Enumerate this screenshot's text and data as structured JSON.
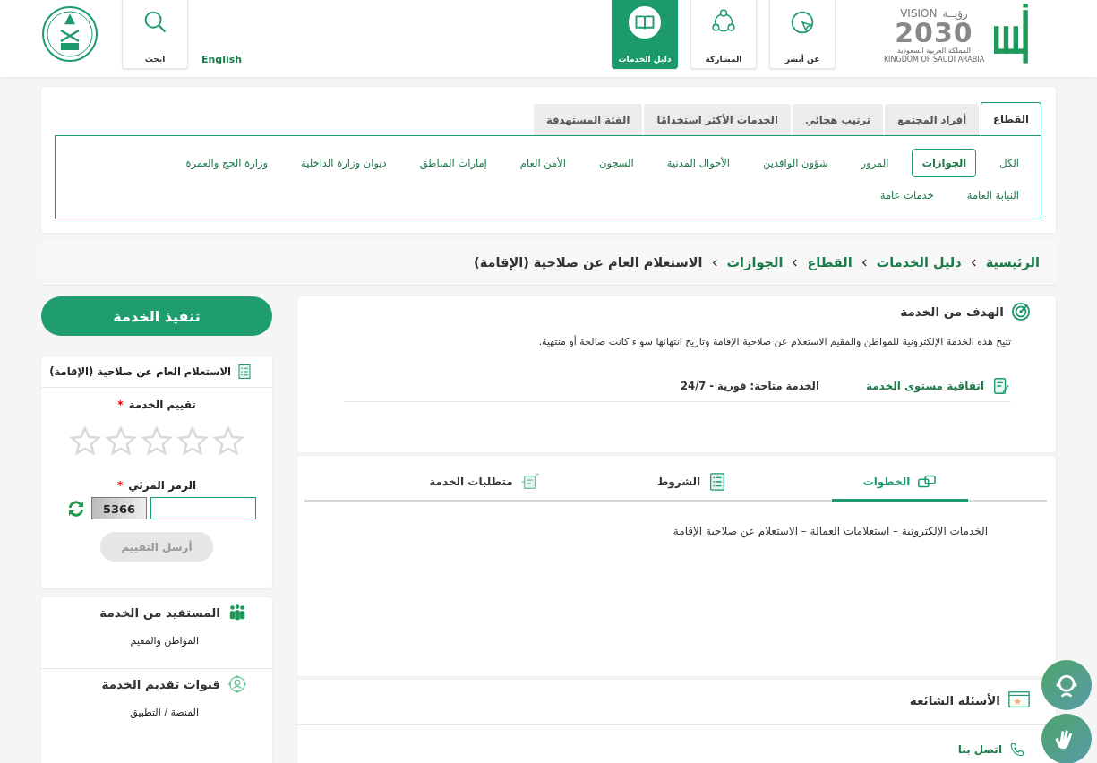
{
  "header": {
    "vision": {
      "word": "VISION",
      "arabic_word": "رؤيــة",
      "year": "2030",
      "country_ar": "المملكة العربية السعودية",
      "country_en": "KINGDOM OF SAUDI ARABIA"
    },
    "nav": [
      {
        "label": "عن أبشر",
        "kind": "about",
        "selected": false
      },
      {
        "label": "المشاركة",
        "kind": "share",
        "selected": false
      },
      {
        "label": "دليل الخدمات",
        "kind": "guide",
        "selected": true
      }
    ],
    "language": "English",
    "search": "ابحث"
  },
  "category_tabs": [
    {
      "label": "القطاع",
      "selected": true
    },
    {
      "label": "أفراد المجتمع",
      "selected": false
    },
    {
      "label": "ترتيب هجائي",
      "selected": false
    },
    {
      "label": "الخدمات الأكثر استخدامًا",
      "selected": false
    },
    {
      "label": "الفئة المستهدفة",
      "selected": false
    }
  ],
  "sectors": [
    {
      "label": "الكل",
      "selected": false
    },
    {
      "label": "الجوازات",
      "selected": true
    },
    {
      "label": "المرور",
      "selected": false
    },
    {
      "label": "شؤون الوافدين",
      "selected": false
    },
    {
      "label": "الأحوال المدنية",
      "selected": false
    },
    {
      "label": "السجون",
      "selected": false
    },
    {
      "label": "الأمن العام",
      "selected": false
    },
    {
      "label": "إمارات المناطق",
      "selected": false
    },
    {
      "label": "ديوان وزارة الداخلية",
      "selected": false
    },
    {
      "label": "وزارة الحج والعمرة",
      "selected": false
    },
    {
      "label": "النيابة العامة",
      "selected": false
    },
    {
      "label": "خدمات عامة",
      "selected": false
    }
  ],
  "breadcrumb": [
    {
      "label": "الرئيسية",
      "kind": "link"
    },
    {
      "label": "دليل الخدمات",
      "kind": "link"
    },
    {
      "label": "القطاع",
      "kind": "link"
    },
    {
      "label": "الجوازات",
      "kind": "link"
    },
    {
      "label": "الاستعلام العام عن صلاحية (الإقامة)",
      "kind": "current"
    }
  ],
  "goal": {
    "title": "الهدف من الخدمة",
    "text": "تتيح هذه الخدمة الإلكترونية للمواطن والمقيم الاستعلام عن صلاحية الإقامة وتاريخ انتهائها سواء كانت صالحة أو منتهية.",
    "sla_label": "اتفاقية مستوى الخدمة",
    "availability": "الخدمة متاحة: فورية - 24/7"
  },
  "detail_tabs": [
    {
      "label": "الخطوات",
      "kind": "steps",
      "selected": true
    },
    {
      "label": "الشروط",
      "kind": "terms",
      "selected": false
    },
    {
      "label": "متطلبات الخدمة",
      "kind": "requirements",
      "selected": false
    }
  ],
  "steps_text": "الخدمات الإلكترونية – استعلامات العمالة – الاستعلام عن صلاحية الإقامة",
  "faq": {
    "title": "الأسئلة الشائعة"
  },
  "contact": {
    "label": "اتصل بنا"
  },
  "sidebar": {
    "execute_button": "تنفيذ الخدمة",
    "service_card": {
      "title": "الاستعلام العام عن صلاحية (الإقامة)",
      "rating_label": "تقييم الخدمة",
      "required_mark": "*",
      "stars": 0,
      "captcha_label": "الرمز المرئي",
      "captcha_text": "5366",
      "submit_label": "أرسل التقييم",
      "submit_disabled": true
    },
    "beneficiary": {
      "title": "المستفيد من الخدمة",
      "text": "المواطن والمقيم"
    },
    "channels": {
      "title": "قنوات تقديم الخدمة",
      "text": "المنصة / التطبيق"
    }
  }
}
